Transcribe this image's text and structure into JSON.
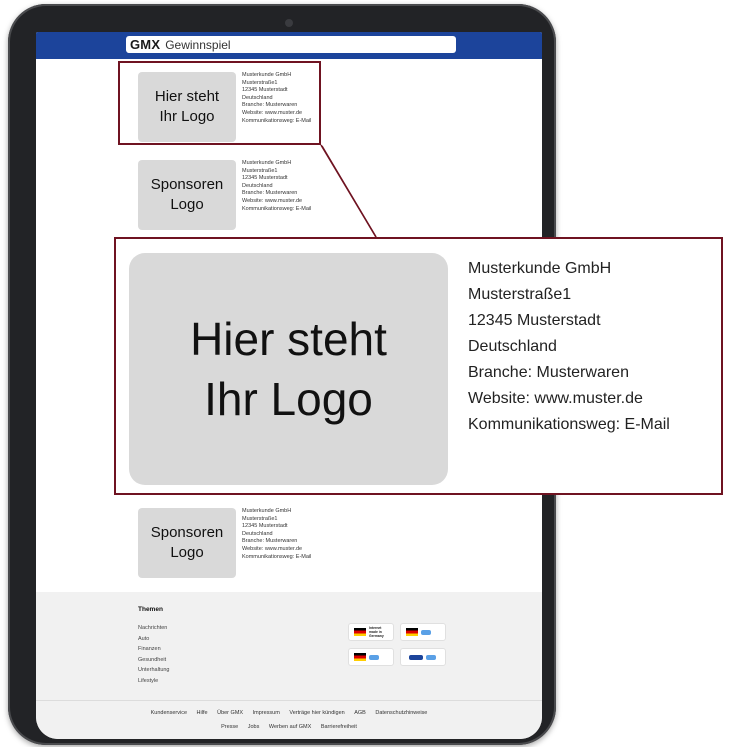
{
  "header": {
    "brand": "GMX",
    "title": "Gewinnspiel"
  },
  "sponsors": [
    {
      "logo_line1": "Hier steht",
      "logo_line2": "Ihr Logo",
      "lines": [
        "Musterkunde GmbH",
        "Musterstraße1",
        "12345 Musterstadt",
        "Deutschland",
        "Branche: Musterwaren",
        "Website: www.muster.de",
        "Kommunikationsweg: E-Mail"
      ]
    },
    {
      "logo_line1": "Sponsoren",
      "logo_line2": "Logo",
      "lines": [
        "Musterkunde GmbH",
        "Musterstraße1",
        "12345 Musterstadt",
        "Deutschland",
        "Branche: Musterwaren",
        "Website: www.muster.de",
        "Kommunikationsweg: E-Mail"
      ]
    },
    {
      "logo_line1": "Sponsoren",
      "logo_line2": "Logo",
      "lines": [
        "Musterkunde GmbH",
        "Musterstraße1",
        "12345 Musterstadt",
        "Deutschland",
        "Branche: Musterwaren",
        "Website: www.muster.de",
        "Kommunikationsweg: E-Mail"
      ]
    }
  ],
  "zoom": {
    "logo_line1": "Hier steht",
    "logo_line2": "Ihr Logo",
    "lines": [
      "Musterkunde GmbH",
      "Musterstraße1",
      "12345 Musterstadt",
      "Deutschland",
      "Branche: Musterwaren",
      "Website: www.muster.de",
      "Kommunikationsweg: E-Mail"
    ]
  },
  "footer": {
    "themen_title": "Themen",
    "themen": [
      "Nachrichten",
      "Auto",
      "Finanzen",
      "Gesundheit",
      "Unterhaltung",
      "Lifestyle"
    ],
    "badges": [
      {
        "text1": "Internet",
        "text2": "made in",
        "text3": "Germany"
      },
      {
        "text1": "",
        "text2": "",
        "text3": ""
      },
      {
        "text1": "",
        "text2": "",
        "text3": ""
      },
      {
        "text1": "",
        "text2": "",
        "text3": ""
      }
    ],
    "links_row1": [
      "Kundenservice",
      "Hilfe",
      "Über GMX",
      "Impressum",
      "Verträge hier kündigen",
      "AGB",
      "Datenschutzhinweise"
    ],
    "links_row2": [
      "Presse",
      "Jobs",
      "Werben auf GMX",
      "Barrierefreiheit"
    ]
  },
  "colors": {
    "header_blue": "#1c449b",
    "accent_maroon": "#6f1321",
    "logo_gray": "#d9d9d9"
  }
}
